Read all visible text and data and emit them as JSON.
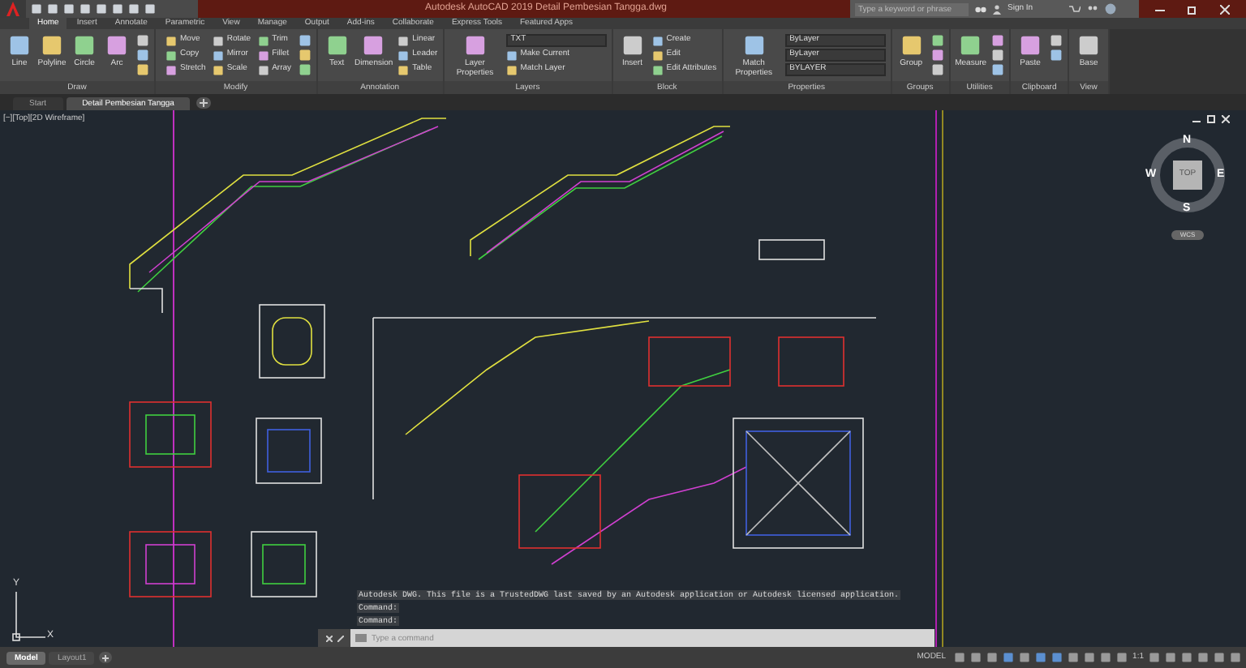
{
  "title_bar": {
    "title": "Autodesk AutoCAD 2019    Detail Pembesian Tangga.dwg",
    "search_placeholder": "Type a keyword or phrase",
    "sign_in": "Sign In"
  },
  "ribbon_tabs": [
    {
      "label": "Home",
      "selected": true
    },
    {
      "label": "Insert",
      "selected": false
    },
    {
      "label": "Annotate",
      "selected": false
    },
    {
      "label": "Parametric",
      "selected": false
    },
    {
      "label": "View",
      "selected": false
    },
    {
      "label": "Manage",
      "selected": false
    },
    {
      "label": "Output",
      "selected": false
    },
    {
      "label": "Add-ins",
      "selected": false
    },
    {
      "label": "Collaborate",
      "selected": false
    },
    {
      "label": "Express Tools",
      "selected": false
    },
    {
      "label": "Featured Apps",
      "selected": false
    }
  ],
  "ribbon_panels": [
    {
      "title": "Draw",
      "tools": [
        {
          "kind": "large",
          "label": "Line"
        },
        {
          "kind": "large",
          "label": "Polyline"
        },
        {
          "kind": "large",
          "label": "Circle"
        },
        {
          "kind": "large",
          "label": "Arc"
        },
        {
          "kind": "icon"
        },
        {
          "kind": "icon"
        },
        {
          "kind": "icon"
        }
      ]
    },
    {
      "title": "Modify",
      "tools": [
        {
          "kind": "small",
          "label": "Move"
        },
        {
          "kind": "small",
          "label": "Copy"
        },
        {
          "kind": "small",
          "label": "Stretch"
        },
        {
          "kind": "small",
          "label": "Rotate"
        },
        {
          "kind": "small",
          "label": "Mirror"
        },
        {
          "kind": "small",
          "label": "Scale"
        },
        {
          "kind": "small",
          "label": "Trim"
        },
        {
          "kind": "small",
          "label": "Fillet"
        },
        {
          "kind": "small",
          "label": "Array"
        },
        {
          "kind": "icon"
        },
        {
          "kind": "icon"
        },
        {
          "kind": "icon"
        }
      ]
    },
    {
      "title": "Annotation",
      "tools": [
        {
          "kind": "large",
          "label": "Text"
        },
        {
          "kind": "large",
          "label": "Dimension"
        },
        {
          "kind": "small",
          "label": "Linear"
        },
        {
          "kind": "small",
          "label": "Leader"
        },
        {
          "kind": "small",
          "label": "Table"
        }
      ]
    },
    {
      "title": "Layers",
      "tools": [
        {
          "kind": "large",
          "label": "Layer Properties"
        },
        {
          "kind": "dropdown",
          "label": "TXT"
        },
        {
          "kind": "small",
          "label": "Make Current"
        },
        {
          "kind": "small",
          "label": "Match Layer"
        }
      ]
    },
    {
      "title": "Block",
      "tools": [
        {
          "kind": "large",
          "label": "Insert"
        },
        {
          "kind": "small",
          "label": "Create"
        },
        {
          "kind": "small",
          "label": "Edit"
        },
        {
          "kind": "small",
          "label": "Edit Attributes"
        }
      ]
    },
    {
      "title": "Properties",
      "tools": [
        {
          "kind": "large",
          "label": "Match Properties"
        },
        {
          "kind": "dropdown",
          "label": "ByLayer"
        },
        {
          "kind": "dropdown",
          "label": "ByLayer"
        },
        {
          "kind": "dropdown",
          "label": "BYLAYER"
        }
      ]
    },
    {
      "title": "Groups",
      "tools": [
        {
          "kind": "large",
          "label": "Group"
        },
        {
          "kind": "icon"
        },
        {
          "kind": "icon"
        },
        {
          "kind": "icon"
        }
      ]
    },
    {
      "title": "Utilities",
      "tools": [
        {
          "kind": "large",
          "label": "Measure"
        },
        {
          "kind": "icon"
        },
        {
          "kind": "icon"
        },
        {
          "kind": "icon"
        }
      ]
    },
    {
      "title": "Clipboard",
      "tools": [
        {
          "kind": "large",
          "label": "Paste"
        },
        {
          "kind": "icon"
        },
        {
          "kind": "icon"
        }
      ]
    },
    {
      "title": "View",
      "tools": [
        {
          "kind": "large",
          "label": "Base"
        }
      ]
    }
  ],
  "file_tabs": [
    {
      "label": "Start",
      "selected": false
    },
    {
      "label": "Detail Pembesian Tangga",
      "selected": true
    }
  ],
  "viewport": {
    "label": "[−][Top][2D Wireframe]"
  },
  "view_cube": {
    "north": "N",
    "south": "S",
    "east": "E",
    "west": "W",
    "face": "TOP",
    "ucs": "WCS"
  },
  "ucs_axes": {
    "y": "Y",
    "x": "X"
  },
  "command_history": [
    "Autodesk DWG.  This file is a TrustedDWG last saved by an Autodesk application or Autodesk licensed application.",
    "Command:",
    "Command:"
  ],
  "command_line": {
    "placeholder": "Type a command"
  },
  "layout_tabs": [
    {
      "label": "Model",
      "selected": true
    },
    {
      "label": "Layout1",
      "selected": false
    }
  ],
  "status_bar": {
    "mode": "MODEL",
    "scale": "1:1"
  }
}
